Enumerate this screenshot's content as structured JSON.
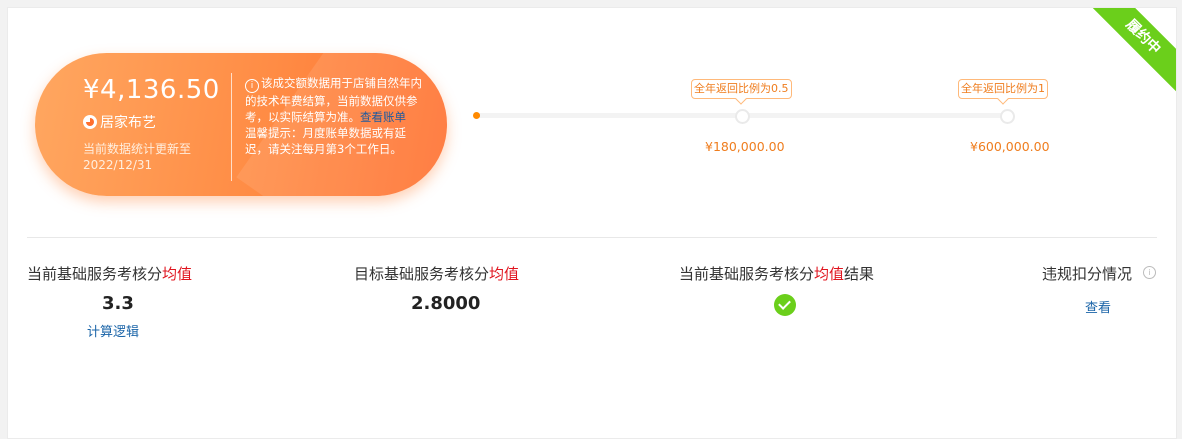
{
  "status": {
    "ribbon_label": "履约中",
    "ribbon_color": "#6bcf1b"
  },
  "summary": {
    "amount": "¥4,136.50",
    "category": "居家布艺",
    "update_note": "当前数据统计更新至2022/12/31",
    "notice_part1": "该成交额数据用于店铺自然年内的技术年费结算，当前数据仅供参考，以实际结算为准。",
    "notice_link": "查看账单",
    "notice_part2": "温馨提示：月度账单数据或有延迟，请关注每月第3个工作日。"
  },
  "progress": {
    "current_amount": 4136.5,
    "milestones": [
      {
        "tip": "全年返回比例为0.5",
        "amount": "¥180,000.00",
        "value": 180000
      },
      {
        "tip": "全年返回比例为1",
        "amount": "¥600,000.00",
        "value": 600000
      }
    ]
  },
  "metrics": {
    "current_score": {
      "label_prefix": "当前基础服务考核分",
      "label_highlight": "均值",
      "value": "3.3",
      "link": "计算逻辑"
    },
    "target_score": {
      "label_prefix": "目标基础服务考核分",
      "label_highlight": "均值",
      "value": "2.8000"
    },
    "result": {
      "label_prefix": "当前基础服务考核分",
      "label_highlight": "均值",
      "label_suffix": "结果",
      "status": "pass"
    },
    "violations": {
      "label": "违规扣分情况",
      "link": "查看"
    }
  },
  "colors": {
    "accent": "#ff8a00",
    "highlight_red": "#e0141e",
    "link_blue": "#1a64a8",
    "success_green": "#6bcf1b"
  }
}
